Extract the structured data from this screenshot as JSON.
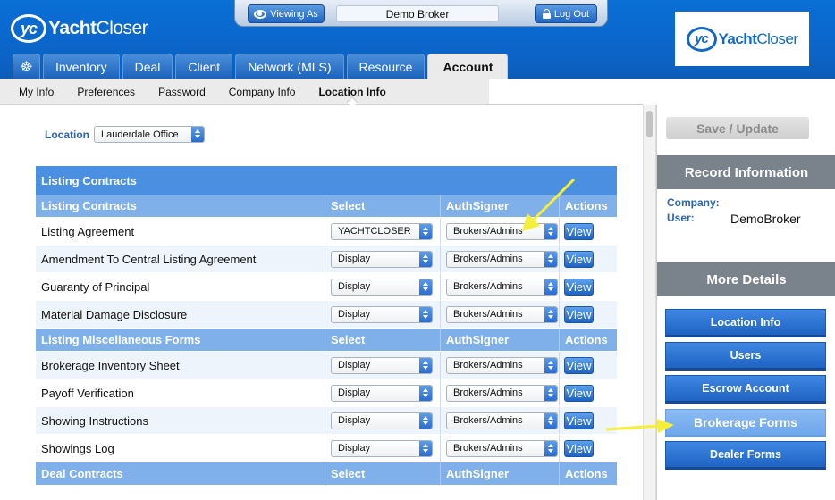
{
  "header": {
    "logo_mark": "yc",
    "logo_text_bold": "Yacht",
    "logo_text_rest": "Closer",
    "viewing_as_label": "Viewing As",
    "broker_name": "Demo Broker",
    "logout_label": "Log Out"
  },
  "tabs": [
    {
      "label": "Inventory"
    },
    {
      "label": "Deal"
    },
    {
      "label": "Client"
    },
    {
      "label": "Network (MLS)"
    },
    {
      "label": "Resource"
    },
    {
      "label": "Account",
      "active": true
    }
  ],
  "subnav": [
    {
      "label": "My Info"
    },
    {
      "label": "Preferences"
    },
    {
      "label": "Password"
    },
    {
      "label": "Company Info"
    },
    {
      "label": "Location Info",
      "active": true
    }
  ],
  "location": {
    "label": "Location",
    "selected": "Lauderdale Office"
  },
  "table": {
    "title": "Listing Contracts",
    "sections": [
      {
        "headers": [
          "Listing Contracts",
          "Select",
          "AuthSigner",
          "Actions"
        ],
        "rows": [
          {
            "name": "Listing Agreement",
            "select": "YACHTCLOSER",
            "auth": "Brokers/Admins",
            "action": "View"
          },
          {
            "name": "Amendment To Central Listing Agreement",
            "select": "Display",
            "auth": "Brokers/Admins",
            "action": "View"
          },
          {
            "name": "Guaranty of Principal",
            "select": "Display",
            "auth": "Brokers/Admins",
            "action": "View"
          },
          {
            "name": "Material Damage Disclosure",
            "select": "Display",
            "auth": "Brokers/Admins",
            "action": "View"
          }
        ]
      },
      {
        "headers": [
          "Listing Miscellaneous Forms",
          "Select",
          "AuthSigner",
          "Actions"
        ],
        "rows": [
          {
            "name": "Brokerage Inventory Sheet",
            "select": "Display",
            "auth": "Brokers/Admins",
            "action": "View"
          },
          {
            "name": "Payoff Verification",
            "select": "Display",
            "auth": "Brokers/Admins",
            "action": "View"
          },
          {
            "name": "Showing Instructions",
            "select": "Display",
            "auth": "Brokers/Admins",
            "action": "View"
          },
          {
            "name": "Showings Log",
            "select": "Display",
            "auth": "Brokers/Admins",
            "action": "View"
          }
        ]
      },
      {
        "headers": [
          "Deal Contracts",
          "Select",
          "AuthSigner",
          "Actions"
        ],
        "rows": []
      }
    ]
  },
  "right_panel": {
    "save_label": "Save / Update",
    "record_title": "Record Information",
    "company_label": "Company:",
    "company_value": "",
    "user_label": "User:",
    "user_value": "DemoBroker",
    "details_title": "More Details",
    "buttons": [
      {
        "label": "Location Info"
      },
      {
        "label": "Users"
      },
      {
        "label": "Escrow Account"
      },
      {
        "label": "Brokerage Forms",
        "highlight": true
      },
      {
        "label": "Dealer Forms"
      }
    ]
  },
  "icons": {
    "tab_home": "helm-icon",
    "viewing": "eye-icon",
    "logout": "lock-icon"
  },
  "colors": {
    "header_blue": "#0b64c7",
    "table_title": "#4a8fe0",
    "table_header": "#7fb0ea",
    "panel_head": "#7a828c",
    "label_blue": "#2a64b8",
    "annotation_arrow": "#f5ee3a"
  }
}
